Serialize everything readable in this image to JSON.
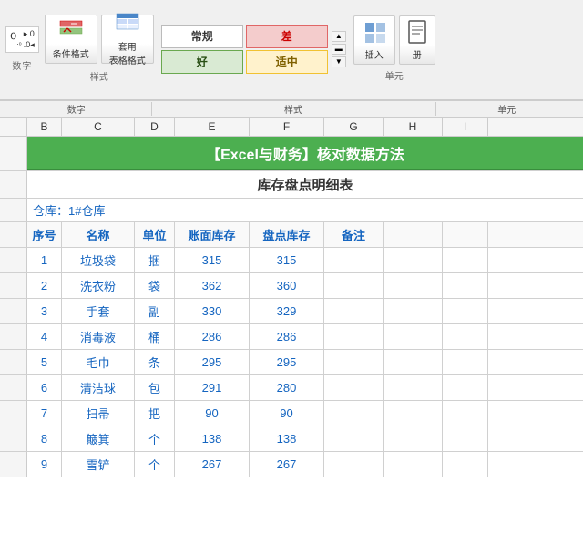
{
  "ribbon": {
    "number_format_label": "数字",
    "style_section_label": "样式",
    "single_section_label": "单元",
    "insert_label": "插入",
    "page_label": "册",
    "conditional_format_label": "条件格式",
    "apply_table_label": "套用\n表格格式",
    "styles": {
      "normal_label": "常规",
      "bad_label": "差",
      "good_label": "好",
      "medium_label": "适中"
    },
    "scroll_up": "▲",
    "scroll_mid": "▬",
    "scroll_down": "▼"
  },
  "spreadsheet": {
    "col_headers": [
      "B",
      "C",
      "D",
      "E",
      "F",
      "G",
      "H",
      "I"
    ],
    "title": "【Excel与财务】核对数据方法",
    "subtitle": "库存盘点明细表",
    "warehouse_label": "仓库：1#仓库",
    "table_headers": {
      "seq": "序号",
      "name": "名称",
      "unit": "单位",
      "book_stock": "账面库存",
      "actual_stock": "盘点库存",
      "remark": "备注"
    },
    "rows": [
      {
        "seq": "1",
        "name": "垃圾袋",
        "unit": "捆",
        "book_stock": "315",
        "actual_stock": "315",
        "remark": ""
      },
      {
        "seq": "2",
        "name": "洗衣粉",
        "unit": "袋",
        "book_stock": "362",
        "actual_stock": "360",
        "remark": ""
      },
      {
        "seq": "3",
        "name": "手套",
        "unit": "副",
        "book_stock": "330",
        "actual_stock": "329",
        "remark": ""
      },
      {
        "seq": "4",
        "name": "消毒液",
        "unit": "桶",
        "book_stock": "286",
        "actual_stock": "286",
        "remark": ""
      },
      {
        "seq": "5",
        "name": "毛巾",
        "unit": "条",
        "book_stock": "295",
        "actual_stock": "295",
        "remark": ""
      },
      {
        "seq": "6",
        "name": "清洁球",
        "unit": "包",
        "book_stock": "291",
        "actual_stock": "280",
        "remark": ""
      },
      {
        "seq": "7",
        "name": "扫帚",
        "unit": "把",
        "book_stock": "90",
        "actual_stock": "90",
        "remark": ""
      },
      {
        "seq": "8",
        "name": "簸箕",
        "unit": "个",
        "book_stock": "138",
        "actual_stock": "138",
        "remark": ""
      },
      {
        "seq": "9",
        "name": "雪铲",
        "unit": "个",
        "book_stock": "267",
        "actual_stock": "267",
        "remark": ""
      }
    ]
  }
}
